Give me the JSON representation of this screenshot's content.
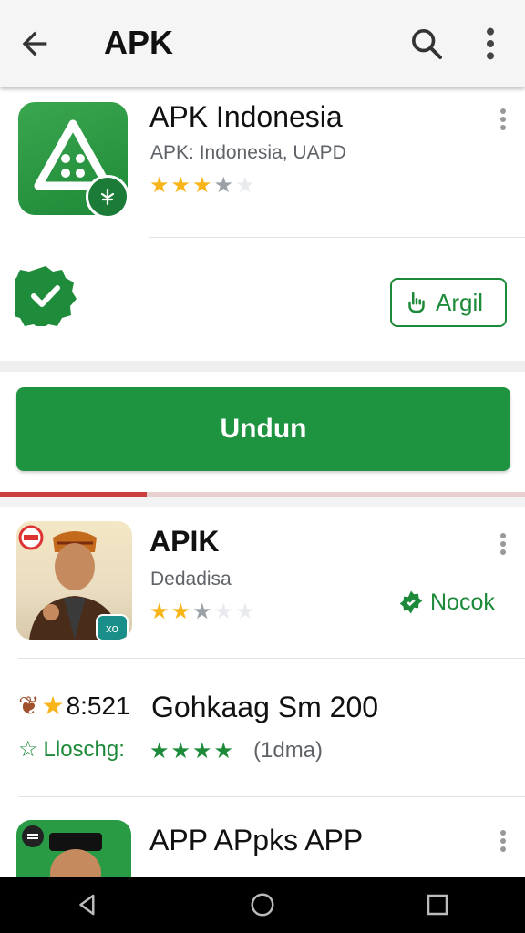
{
  "appbar": {
    "title": "APK",
    "back_icon": "arrow-back-icon",
    "search_icon": "search-icon",
    "more_icon": "more-vert-icon"
  },
  "featured": {
    "name": "APK Indonesia",
    "subtitle": "APK: Indonesia, UAPD",
    "rating_stars": 3.5,
    "action_label": "Argil",
    "download_label": "Undun",
    "download_progress": 0.28,
    "colors": {
      "accent": "#1e9440",
      "progress": "#c9403f"
    }
  },
  "list": [
    {
      "name": "APIK",
      "subtitle": "Dedadisa",
      "rating_stars": 2.5,
      "action_label": "Nocok",
      "badge": "xo"
    },
    {
      "prefix": "8:521",
      "name": "Gohkaag Sm 200",
      "subtitle": "Lloschg:",
      "rating_stars": 4,
      "rating_count": "(1dma)"
    },
    {
      "name": "APP APpks APP"
    }
  ],
  "system_nav": [
    "back-icon",
    "home-icon",
    "recents-icon"
  ]
}
